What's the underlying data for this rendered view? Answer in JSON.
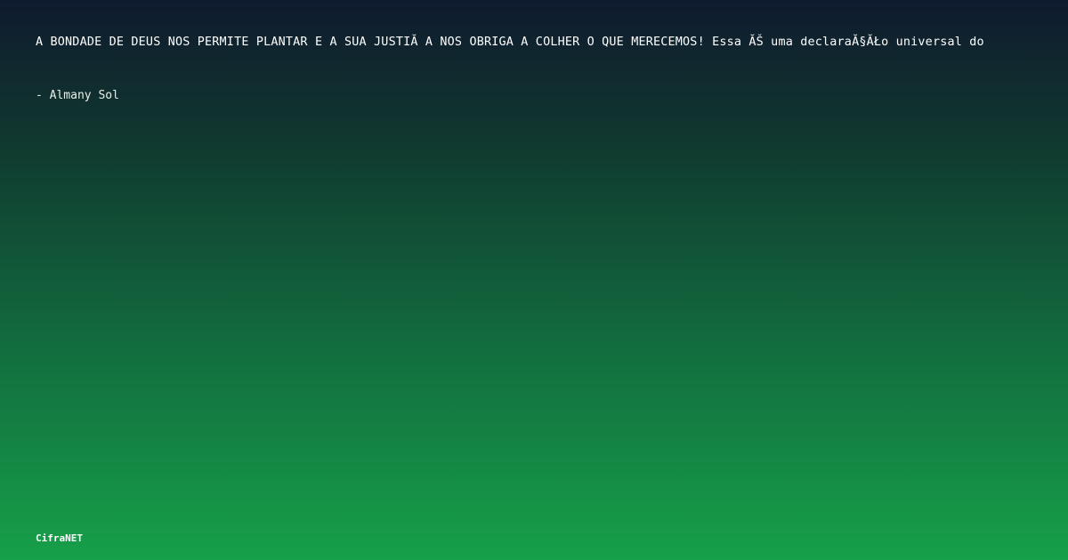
{
  "quote": {
    "text": "A BONDADE DE DEUS NOS PERMITE PLANTAR E A SUA JUSTIĂ A NOS OBRIGA A COLHER O QUE MERECEMOS! Essa ĂŠ uma declaraĂ§ĂŁo universal do",
    "author": "- Almany Sol"
  },
  "brand": {
    "name": "CifraNET"
  },
  "colors": {
    "gradient_top": "#0f1a2e",
    "gradient_bottom": "#16a049",
    "text": "#ffffff"
  }
}
